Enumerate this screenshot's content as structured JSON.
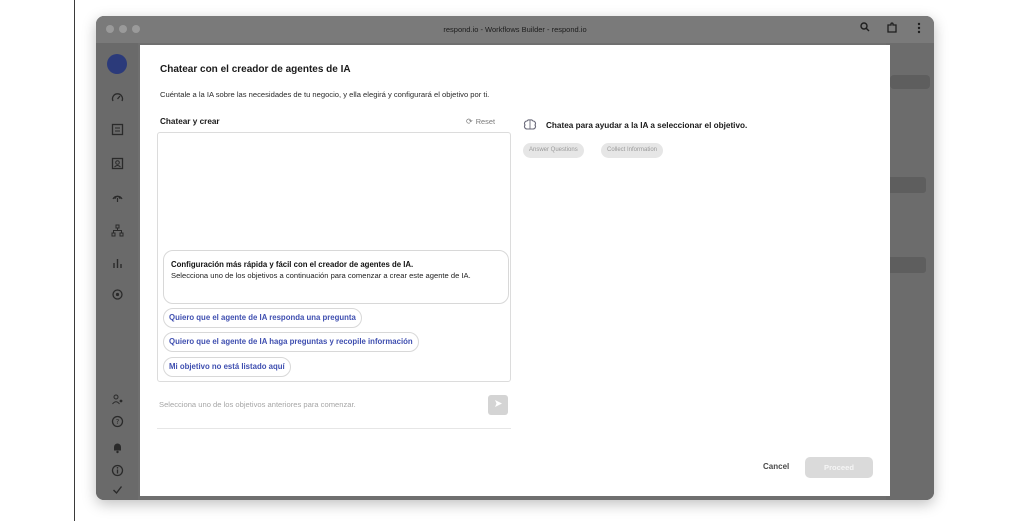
{
  "window": {
    "title": "respond.io - Workflows Builder - respond.io"
  },
  "toolbar": {
    "zoom_icon": "magnifier-icon",
    "extensions_icon": "puzzle-icon",
    "menu_icon": "kebab-menu-icon"
  },
  "sidebar": {
    "icons": [
      "dashboard-icon",
      "inbox-icon",
      "contacts-icon",
      "broadcast-icon",
      "workflows-icon",
      "reports-icon",
      "settings-icon",
      "users-icon",
      "help-icon",
      "notification-icon",
      "info-icon",
      "check-icon"
    ]
  },
  "modal": {
    "title": "Chatear con el creador de agentes de IA",
    "subtitle": "Cuéntale a la IA sobre las necesidades de tu negocio, y ella elegirá y configurará el objetivo por ti.",
    "chat": {
      "heading": "Chatear y crear",
      "reset_label": "Reset",
      "message_title": "Configuración más rápida y fácil con el creador de agentes de IA.",
      "message_body": "Selecciona uno de los objetivos a continuación para comenzar a crear este agente de IA.",
      "options": [
        "Quiero que el agente de IA responda una pregunta",
        "Quiero que el agente de IA haga preguntas y recopile información",
        "Mi objetivo no está listado aquí"
      ],
      "input_placeholder": "Selecciona uno de los objetivos anteriores para comenzar."
    },
    "goal": {
      "heading": "Chatea para ayudar a la IA a seleccionar el objetivo.",
      "chips": [
        "Answer Questions",
        "Collect Information"
      ]
    },
    "footer": {
      "cancel_label": "Cancel",
      "proceed_label": "Proceed"
    }
  },
  "colors": {
    "accent": "#3f4fb0",
    "overlay": "#6f6f6f"
  }
}
